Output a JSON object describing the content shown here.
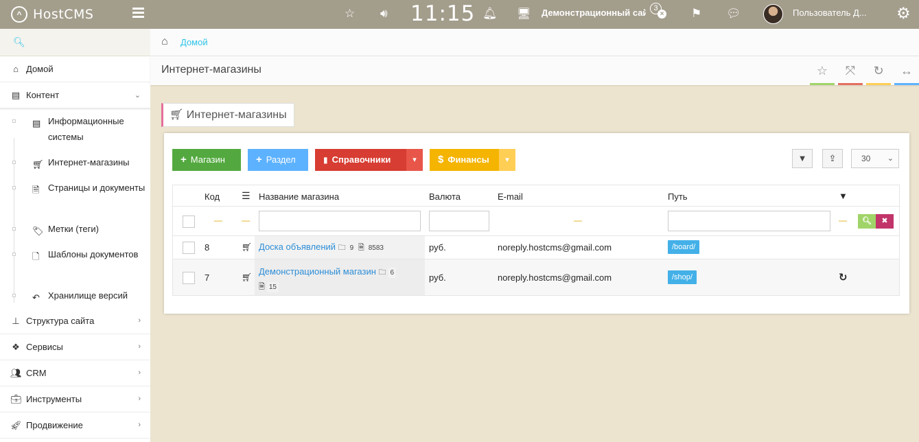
{
  "topbar": {
    "logo_text": "HostCMS",
    "clock": "11:15",
    "site_name": "Демонстрационный сайт",
    "site_badge": "3",
    "username": "Пользователь Д..."
  },
  "sidebar": {
    "items": [
      {
        "label": "Домой",
        "icon": "home-icon"
      },
      {
        "label": "Контент",
        "icon": "newspaper-icon"
      },
      {
        "label": "Структура сайта",
        "icon": "sitemap-icon"
      },
      {
        "label": "Сервисы",
        "icon": "cubes-icon"
      },
      {
        "label": "CRM",
        "icon": "users-icon"
      },
      {
        "label": "Инструменты",
        "icon": "briefcase-icon"
      },
      {
        "label": "Продвижение",
        "icon": "rocket-icon"
      }
    ],
    "subitems": [
      {
        "label": "Информационные системы",
        "icon": "newspaper-icon"
      },
      {
        "label": "Интернет-магазины",
        "icon": "cart-icon"
      },
      {
        "label": "Страницы и документы",
        "icon": "file-icon"
      },
      {
        "label": "Метки (теги)",
        "icon": "tags-icon"
      },
      {
        "label": "Шаблоны документов",
        "icon": "word-file-icon"
      },
      {
        "label": "Хранилище версий",
        "icon": "undo-icon"
      }
    ]
  },
  "breadcrumb": {
    "home_label": "Домой"
  },
  "page": {
    "title": "Интернет-магазины",
    "action_colors": [
      "#a0d468",
      "#e46f61",
      "#ffce55",
      "#5db2ff"
    ]
  },
  "widget": {
    "title": "Интернет-магазины",
    "buttons": {
      "shop": "Магазин",
      "section": "Раздел",
      "dictionaries": "Справочники",
      "finance": "Финансы"
    },
    "colors": {
      "shop": "#53a93f",
      "section": "#5db2ff",
      "dictionaries": "#d73d32",
      "finance": "#f4b400"
    },
    "page_size": "30",
    "columns": {
      "code": "Код",
      "name": "Название магазина",
      "currency": "Валюта",
      "email": "E-mail",
      "path": "Путь"
    },
    "rows": [
      {
        "code": "8",
        "name": "Доска объявлений",
        "groups": "9",
        "items": "8583",
        "currency": "руб.",
        "email": "noreply.hostcms@gmail.com",
        "path": "/board/"
      },
      {
        "code": "7",
        "name": "Демонстрационный магазин",
        "groups": "6",
        "items": "15",
        "currency": "руб.",
        "email": "noreply.hostcms@gmail.com",
        "path": "/shop/"
      }
    ]
  }
}
